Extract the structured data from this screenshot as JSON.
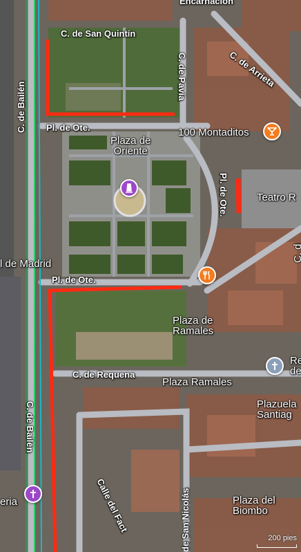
{
  "map": {
    "labels": {
      "encarnacion": "Encarnación",
      "san_quintin": "C. de San Quintín",
      "arrieta": "C. de Arrieta",
      "pavia": "C. de Pavía",
      "bailen_top": "C. de Bailén",
      "pl_ote_1": "Pl. de Ote.",
      "plaza_oriente": "Plaza de\nOriente",
      "montaditos": "100 Montaditos",
      "pl_ote_vert": "Pl. de Ote.",
      "teatro": "Teatro R",
      "madrid": "l de Madrid",
      "pl_ote_2": "Pl. de Ote.",
      "plaza_ramales_1": "Plaza de\nRamales",
      "requena": "C. de Requena",
      "plaza_ramales_2": "Plaza Ramales",
      "plazuela": "Plazuela\nSantiag",
      "re_de": "Re\nde",
      "bailen_bottom": "C. de Bailén",
      "calle_fact": "Calle del Fact",
      "san_nicolas": "de San Nicolás",
      "plaza_biombo": "Plaza del\nBiombo",
      "eria": "eria",
      "c_d": "C. d"
    },
    "pins": {
      "montaditos": {
        "icon": "cocktail-icon",
        "color": "#f57c1f"
      },
      "oriente": {
        "icon": "monument-icon",
        "color": "#9c48c9"
      },
      "restaurant": {
        "icon": "restaurant-icon",
        "color": "#f57c1f"
      },
      "church_right": {
        "icon": "church-icon",
        "color": "#8aa0b8"
      },
      "church_left": {
        "icon": "church-icon",
        "color": "#9c48c9"
      }
    },
    "scale": "200 pies",
    "highlight_color": "#ff2a12"
  }
}
